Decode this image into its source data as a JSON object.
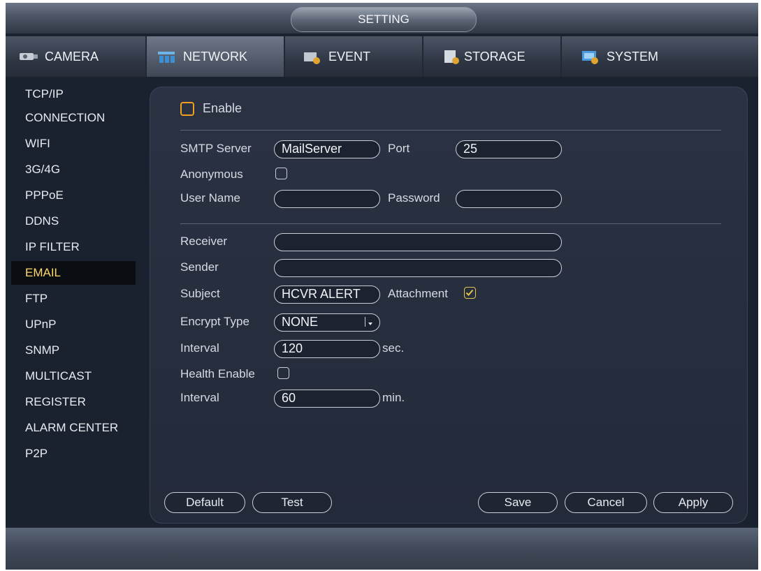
{
  "window": {
    "title": "SETTING"
  },
  "tabs": [
    {
      "label": "CAMERA",
      "icon": "camera-icon"
    },
    {
      "label": "NETWORK",
      "icon": "network-icon",
      "active": true
    },
    {
      "label": "EVENT",
      "icon": "event-icon"
    },
    {
      "label": "STORAGE",
      "icon": "storage-icon"
    },
    {
      "label": "SYSTEM",
      "icon": "system-icon"
    }
  ],
  "sidebar": {
    "items": [
      {
        "label": "TCP/IP"
      },
      {
        "label": "CONNECTION"
      },
      {
        "label": "WIFI"
      },
      {
        "label": "3G/4G"
      },
      {
        "label": "PPPoE"
      },
      {
        "label": "DDNS"
      },
      {
        "label": "IP FILTER"
      },
      {
        "label": "EMAIL",
        "active": true
      },
      {
        "label": "FTP"
      },
      {
        "label": "UPnP"
      },
      {
        "label": "SNMP"
      },
      {
        "label": "MULTICAST"
      },
      {
        "label": "REGISTER"
      },
      {
        "label": "ALARM CENTER"
      },
      {
        "label": "P2P"
      }
    ]
  },
  "email": {
    "enable_label": "Enable",
    "enable_checked": false,
    "smtp_server_label": "SMTP Server",
    "smtp_server_value": "MailServer",
    "port_label": "Port",
    "port_value": "25",
    "anonymous_label": "Anonymous",
    "anonymous_checked": false,
    "username_label": "User Name",
    "username_value": "",
    "password_label": "Password",
    "password_value": "",
    "receiver_label": "Receiver",
    "receiver_value": "",
    "sender_label": "Sender",
    "sender_value": "",
    "subject_label": "Subject",
    "subject_value": "HCVR ALERT",
    "attachment_label": "Attachment",
    "attachment_checked": true,
    "encrypt_label": "Encrypt Type",
    "encrypt_value": "NONE",
    "interval_label": "Interval",
    "interval_value": "120",
    "interval_unit": "sec.",
    "health_label": "Health Enable",
    "health_checked": false,
    "health_interval_label": "Interval",
    "health_interval_value": "60",
    "health_interval_unit": "min."
  },
  "buttons": {
    "default": "Default",
    "test": "Test",
    "save": "Save",
    "cancel": "Cancel",
    "apply": "Apply"
  },
  "colors": {
    "accent_active": "#ffd76a",
    "enable_checkbox": "#f0a020",
    "check_mark": "#e8c24a"
  }
}
